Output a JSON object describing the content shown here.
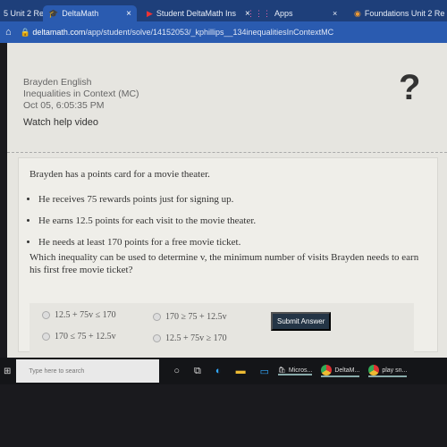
{
  "browser": {
    "tabs": [
      {
        "label": "5 Unit 2 Re"
      },
      {
        "label": "DeltaMath",
        "active": true
      },
      {
        "label": "Student DeltaMath Ins"
      },
      {
        "label": "Apps"
      },
      {
        "label": "Foundations Unit 2 Re"
      }
    ],
    "url_host": "deltamath.com",
    "url_path": "/app/student/solve/14152053/_kphillips__134inequalitiesInContextMC"
  },
  "header": {
    "name": "Brayden English",
    "assignment": "Inequalities in Context (MC)",
    "date": "Oct 05, 6:05:35 PM",
    "watch": "Watch help video",
    "help": "?"
  },
  "problem": {
    "stem": "Brayden has a points card for a movie theater.",
    "bullets": [
      "He receives 75 rewards points just for signing up.",
      "He earns 12.5 points for each visit to the movie theater.",
      "He needs at least 170 points for a free movie ticket."
    ],
    "question": "Which inequality can be used to determine v, the minimum number of visits Brayden needs to earn his first free movie ticket?",
    "choices": [
      "12.5 + 75v ≤ 170",
      "170 ≥ 75 + 12.5v",
      "170 ≤ 75 + 12.5v",
      "12.5 + 75v ≥ 170"
    ],
    "submit": "Submit Answer"
  },
  "taskbar": {
    "search": "Type here to search",
    "apps": [
      "Micros...",
      "DeltaM...",
      "play sn..."
    ]
  }
}
